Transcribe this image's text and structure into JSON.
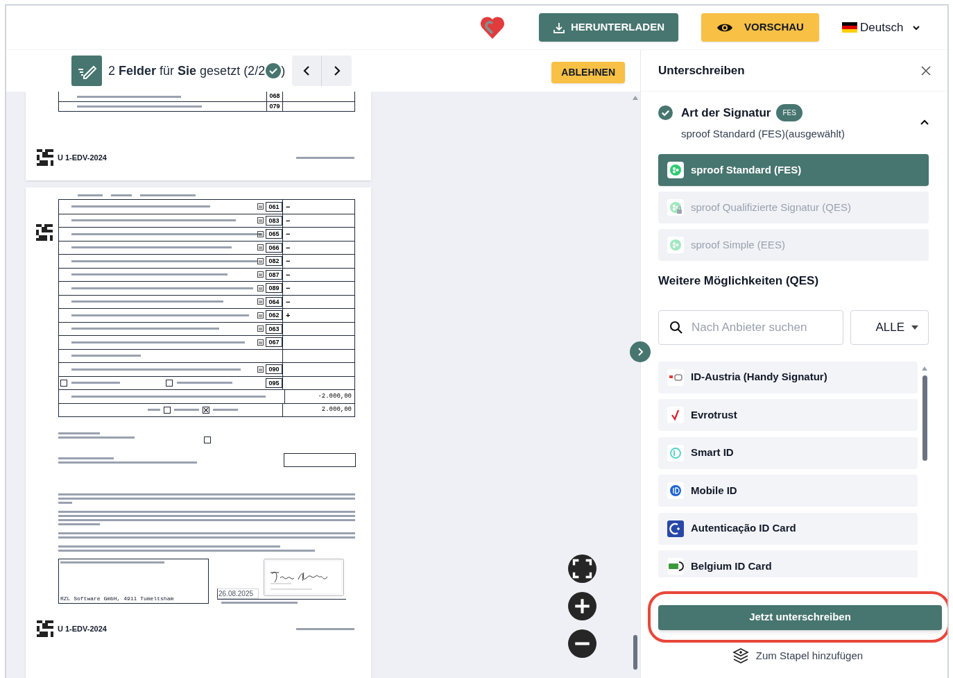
{
  "header": {
    "buttons": [
      {
        "label": "HERUNTERLADEN",
        "kind": "download"
      },
      {
        "label": "VORSCHAU",
        "kind": "preview"
      }
    ],
    "language": "Deutsch"
  },
  "toolbar": {
    "status": "2 **Felder** für **Sie** gesetzt (2/2",
    "status_end": ")",
    "complete": true,
    "reject_button": "ABLEHNEN"
  },
  "document": {
    "page_top": {
      "rows": [
        {
          "code": "068"
        },
        {
          "code": "079"
        }
      ],
      "footer_code": "U 1-EDV-2024"
    },
    "page_form": {
      "rows": [
        {
          "kind": "field",
          "code": "061",
          "sign": "−"
        },
        {
          "kind": "field",
          "code": "083",
          "sign": "−"
        },
        {
          "kind": "field",
          "code": "065",
          "sign": "−"
        },
        {
          "kind": "field",
          "code": "066",
          "sign": "−"
        },
        {
          "kind": "field",
          "code": "082",
          "sign": "−"
        },
        {
          "kind": "field",
          "code": "087",
          "sign": "−"
        },
        {
          "kind": "field",
          "code": "089",
          "sign": "−"
        },
        {
          "kind": "field",
          "code": "064",
          "sign": "−"
        },
        {
          "kind": "field",
          "code": "062",
          "sign": "+"
        },
        {
          "kind": "field",
          "code": "063"
        },
        {
          "kind": "field",
          "code": "067"
        },
        {
          "kind": "heading"
        },
        {
          "kind": "field",
          "code": "090"
        },
        {
          "kind": "checks",
          "code": "095",
          "boxes": [
            {
              "checked": false
            },
            {
              "checked": false
            }
          ]
        },
        {
          "kind": "amount",
          "amount": "-2.000,00"
        },
        {
          "kind": "result",
          "amount": "2.000,00",
          "boxes": [
            {
              "checked": false
            },
            {
              "checked": true
            }
          ]
        }
      ],
      "chamber_checked": false,
      "advisor": "RZL Software GmbH, 4911 Tumeltsham",
      "date": "26.08.2025",
      "footer_code": "U 1-EDV-2024"
    }
  },
  "panel": {
    "title": "Unterschreiben",
    "section": {
      "title": "Art der Signatur",
      "badge": "FES",
      "summary": "sproof Standard (FES)(ausgewählt)",
      "expanded": true,
      "done": true
    },
    "signature_types": [
      {
        "label": "sproof Standard (FES)",
        "selected": true,
        "locked": false
      },
      {
        "label": "sproof Qualifizierte Signatur (QES)",
        "selected": false,
        "locked": true
      },
      {
        "label": "sproof Simple (EES)",
        "selected": false,
        "locked": false
      }
    ],
    "more_title": "Weitere Möglichkeiten (QES)",
    "search": {
      "placeholder": "Nach Anbieter suchen"
    },
    "filter": "ALLE",
    "providers": [
      {
        "label": "ID-Austria (Handy Signatur)",
        "kind": "id-austria"
      },
      {
        "label": "Evrotrust",
        "kind": "evrotrust"
      },
      {
        "label": "Smart ID",
        "kind": "smart-id"
      },
      {
        "label": "Mobile ID",
        "kind": "mobile-id"
      },
      {
        "label": "Autenticação ID Card",
        "kind": "autenticacao"
      },
      {
        "label": "Belgium ID Card",
        "kind": "belgium"
      }
    ],
    "sign_button": {
      "label": "Jetzt unterschreiben",
      "highlighted": true
    },
    "batch_link": "Zum Stapel hinzufügen"
  }
}
